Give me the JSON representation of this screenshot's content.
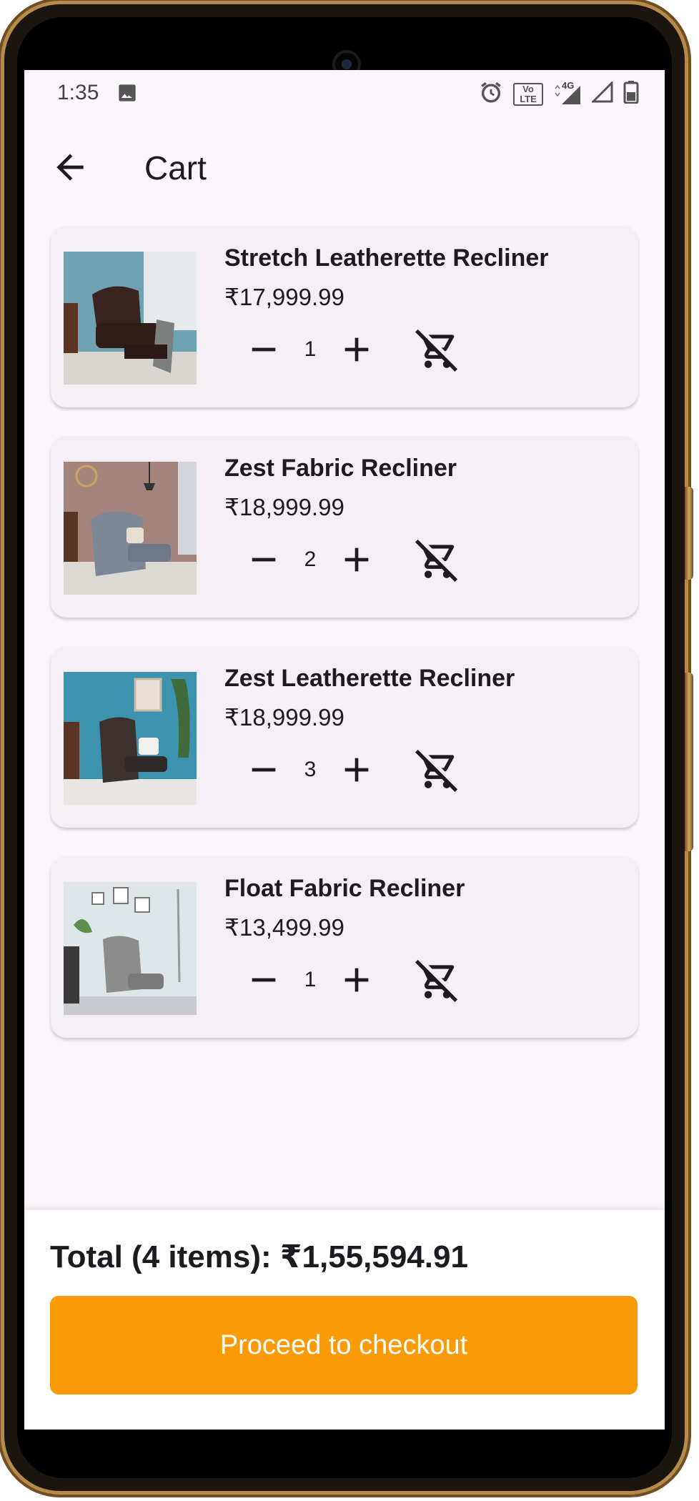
{
  "status_bar": {
    "time": "1:35",
    "left_icons": [
      "image-icon"
    ],
    "right_icons": [
      "alarm-icon",
      "volte-icon",
      "signal-4g-icon",
      "signal-icon",
      "battery-icon"
    ],
    "volte_text": "Vo LTE",
    "network_text": "4G"
  },
  "app_bar": {
    "title": "Cart",
    "back_icon": "arrow-back-icon"
  },
  "cart": {
    "items": [
      {
        "name": "Stretch Leatherette Recliner",
        "price": "₹17,999.99",
        "quantity": "1",
        "wall_color": "#6fa3b3",
        "chair_color": "#3a2421"
      },
      {
        "name": "Zest Fabric Recliner",
        "price": "₹18,999.99",
        "quantity": "2",
        "wall_color": "#a5857b",
        "chair_color": "#7e8796"
      },
      {
        "name": "Zest Leatherette Recliner",
        "price": "₹18,999.99",
        "quantity": "3",
        "wall_color": "#3d93ad",
        "chair_color": "#3b3230"
      },
      {
        "name": "Float Fabric Recliner",
        "price": "₹13,499.99",
        "quantity": "1",
        "wall_color": "#dfe6e9",
        "chair_color": "#8c8c8c"
      }
    ],
    "icons": {
      "minus": "minus-icon",
      "plus": "plus-icon",
      "remove": "remove-shopping-cart-icon"
    }
  },
  "summary": {
    "total_label": "Total (4 items): ₹1,55,594.91",
    "checkout_label": "Proceed to checkout"
  },
  "colors": {
    "background": "#fbf6fb",
    "card": "#f3eff5",
    "accent": "#fb9a07",
    "text": "#1d1b20"
  }
}
